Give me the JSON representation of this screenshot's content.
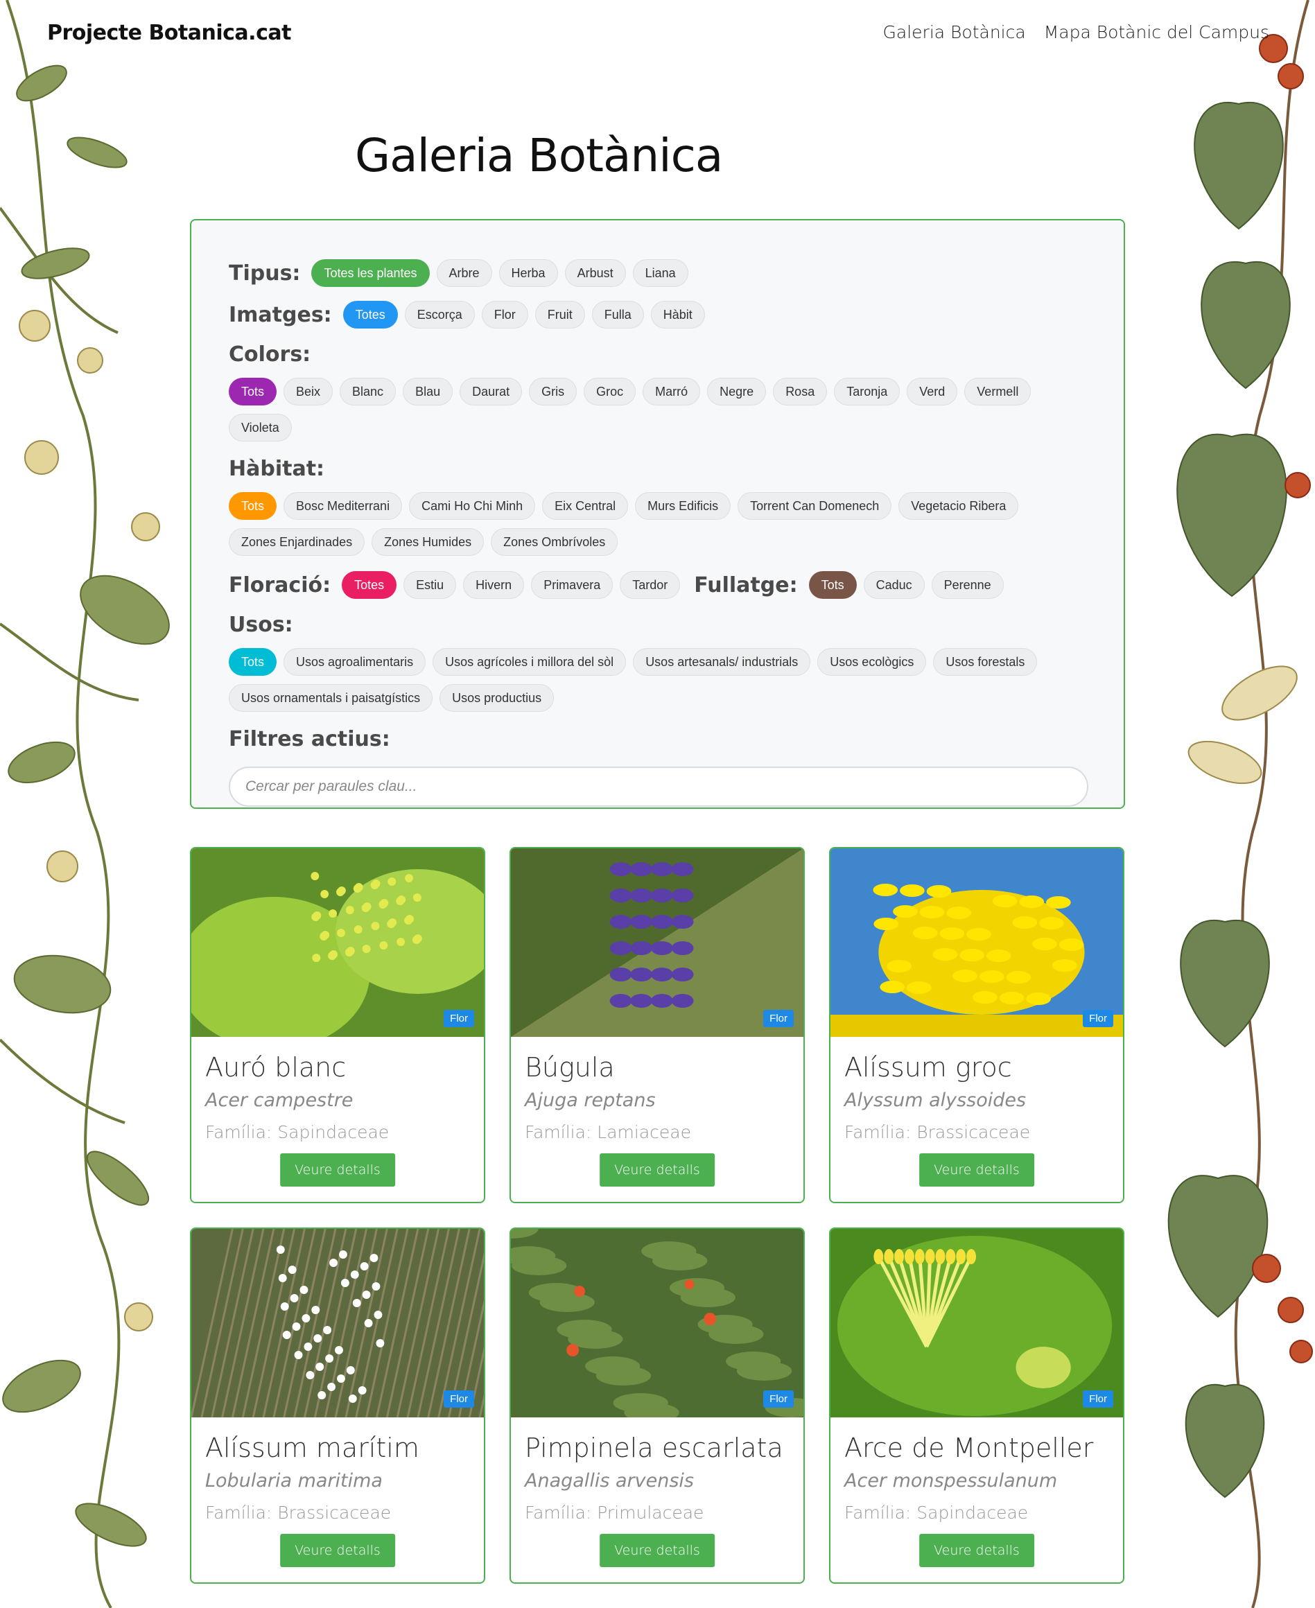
{
  "site": {
    "title": "Projecte Botanica.cat"
  },
  "nav": {
    "items": [
      "Galeria Botànica",
      "Mapa Botànic del Campus"
    ]
  },
  "page": {
    "title": "Galeria Botànica"
  },
  "filters": {
    "tipus": {
      "label": "Tipus:",
      "options": [
        "Totes les plantes",
        "Arbre",
        "Herba",
        "Arbust",
        "Liana"
      ],
      "active": "green"
    },
    "imatges": {
      "label": "Imatges:",
      "options": [
        "Totes",
        "Escorça",
        "Flor",
        "Fruit",
        "Fulla",
        "Hàbit"
      ],
      "active": "blue"
    },
    "colors": {
      "label": "Colors:",
      "options": [
        "Tots",
        "Beix",
        "Blanc",
        "Blau",
        "Daurat",
        "Gris",
        "Groc",
        "Marró",
        "Negre",
        "Rosa",
        "Taronja",
        "Verd",
        "Vermell",
        "Violeta"
      ],
      "active": "purple"
    },
    "habitat": {
      "label": "Hàbitat:",
      "options": [
        "Tots",
        "Bosc Mediterrani",
        "Cami Ho Chi Minh",
        "Eix Central",
        "Murs Edificis",
        "Torrent Can Domenech",
        "Vegetacio Ribera",
        "Zones Enjardinades",
        "Zones Humides",
        "Zones Ombrívoles"
      ],
      "active": "orange"
    },
    "floracio": {
      "label": "Floració:",
      "options": [
        "Totes",
        "Estiu",
        "Hivern",
        "Primavera",
        "Tardor"
      ],
      "active": "pink"
    },
    "fullatge": {
      "label": "Fullatge:",
      "options": [
        "Tots",
        "Caduc",
        "Perenne"
      ],
      "active": "brown"
    },
    "usos": {
      "label": "Usos:",
      "options": [
        "Tots",
        "Usos agroalimentaris",
        "Usos agrícoles i millora del sòl",
        "Usos artesanals/ industrials",
        "Usos ecològics",
        "Usos forestals",
        "Usos ornamentals i paisatgístics",
        "Usos productius"
      ],
      "active": "cyan"
    },
    "active_label": "Filtres actius:",
    "search_placeholder": "Cercar per paraules clau..."
  },
  "cards": [
    {
      "name": "Auró blanc",
      "scientific": "Acer campestre",
      "family": "Família: Sapindaceae",
      "badge": "Flor",
      "button": "Veure detalls",
      "image": "green-maple-flowers"
    },
    {
      "name": "Búgula",
      "scientific": "Ajuga reptans",
      "family": "Família: Lamiaceae",
      "badge": "Flor",
      "button": "Veure detalls",
      "image": "purple-spike-flowers"
    },
    {
      "name": "Alíssum groc",
      "scientific": "Alyssum alyssoides",
      "family": "Família: Brassicaceae",
      "badge": "Flor",
      "button": "Veure detalls",
      "image": "yellow-flowers-blue-sky"
    },
    {
      "name": "Alíssum marítim",
      "scientific": "Lobularia maritima",
      "family": "Família: Brassicaceae",
      "badge": "Flor",
      "button": "Veure detalls",
      "image": "white-small-flowers"
    },
    {
      "name": "Pimpinela escarlata",
      "scientific": "Anagallis arvensis",
      "family": "Família: Primulaceae",
      "badge": "Flor",
      "button": "Veure detalls",
      "image": "red-small-flowers-meadow"
    },
    {
      "name": "Arce de Montpeller",
      "scientific": "Acer monspessulanum",
      "family": "Família: Sapindaceae",
      "badge": "Flor",
      "button": "Veure detalls",
      "image": "yellow-green-stamens"
    }
  ]
}
